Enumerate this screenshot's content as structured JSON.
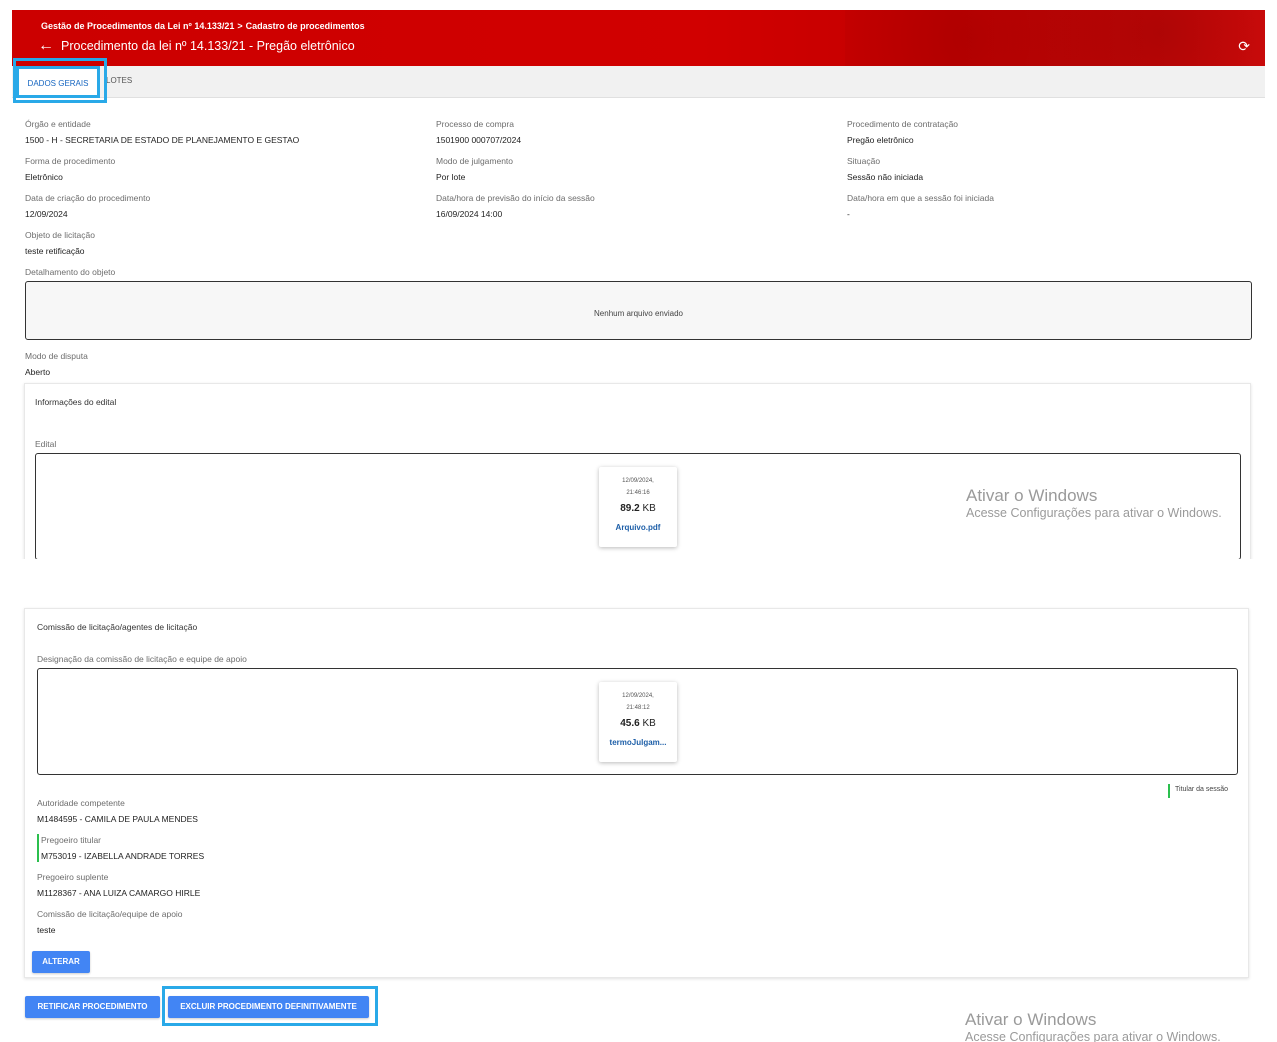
{
  "header": {
    "breadcrumb_root": "Gestão de Procedimentos da Lei nº 14.133/21",
    "breadcrumb_separator": ">",
    "breadcrumb_current": "Cadastro de procedimentos",
    "back_icon": "←",
    "title": "Procedimento da lei nº 14.133/21 - Pregão eletrônico",
    "refresh_icon": "⟳",
    "background_color": "#cc0000"
  },
  "tabs": [
    {
      "label": "DADOS GERAIS",
      "active": true
    },
    {
      "label": "LOTES",
      "active": false
    }
  ],
  "fields": {
    "orgao": {
      "label": "Órgão e entidade",
      "value": "1500 - H - SECRETARIA DE ESTADO DE PLANEJAMENTO E GESTAO"
    },
    "processo": {
      "label": "Processo de compra",
      "value": "1501900 000707/2024"
    },
    "procedimento_contratacao": {
      "label": "Procedimento de contratação",
      "value": "Pregão eletrônico"
    },
    "forma": {
      "label": "Forma de procedimento",
      "value": "Eletrônico"
    },
    "julgamento": {
      "label": "Modo de julgamento",
      "value": "Por lote"
    },
    "situacao": {
      "label": "Situação",
      "value": "Sessão não iniciada"
    },
    "data_criacao": {
      "label": "Data de criação do procedimento",
      "value": "12/09/2024"
    },
    "previsao_inicio": {
      "label": "Data/hora de previsão do início da sessão",
      "value": "16/09/2024 14:00"
    },
    "sessao_iniciada": {
      "label": "Data/hora em que a sessão foi iniciada",
      "value": "-"
    },
    "objeto": {
      "label": "Objeto de licitação",
      "value": "teste retificação"
    },
    "detalhamento": {
      "label": "Detalhamento do objeto",
      "empty_text": "Nenhum arquivo enviado"
    },
    "modo_disputa": {
      "label": "Modo de disputa",
      "value": "Aberto"
    }
  },
  "edital_card": {
    "title": "Informações do edital",
    "section_label": "Edital",
    "file": {
      "date": "12/09/2024,",
      "time": "21:46:16",
      "size_num": "89.2",
      "size_unit": "KB",
      "name": "Arquivo.pdf"
    }
  },
  "comissao_card": {
    "title": "Comissão de licitação/agentes de licitação",
    "section_label": "Designação da comissão de licitação e equipe de apoio",
    "file": {
      "date": "12/09/2024,",
      "time": "21:48:12",
      "size_num": "45.6",
      "size_unit": "KB",
      "name": "termoJulgam..."
    },
    "legend": "Titular da sessão",
    "legend_color": "#2bbf4e",
    "autoridade": {
      "label": "Autoridade competente",
      "value": "M1484595 - CAMILA DE PAULA MENDES"
    },
    "pregoeiro_titular": {
      "label": "Pregoeiro titular",
      "value": "M753019 - IZABELLA ANDRADE TORRES"
    },
    "pregoeiro_suplente": {
      "label": "Pregoeiro suplente",
      "value": "M1128367 - ANA LUIZA CAMARGO HIRLE"
    },
    "equipe_apoio": {
      "label": "Comissão de licitação/equipe de apoio",
      "value": "teste"
    },
    "alterar_label": "ALTERAR"
  },
  "actions": {
    "retificar_label": "RETIFICAR PROCEDIMENTO",
    "excluir_label": "EXCLUIR PROCEDIMENTO DEFINITIVAMENTE",
    "button_color": "#4285f4",
    "highlight_color": "#29a9e8"
  },
  "watermark": {
    "title": "Ativar o Windows",
    "subtitle": "Acesse Configurações para ativar o Windows."
  }
}
